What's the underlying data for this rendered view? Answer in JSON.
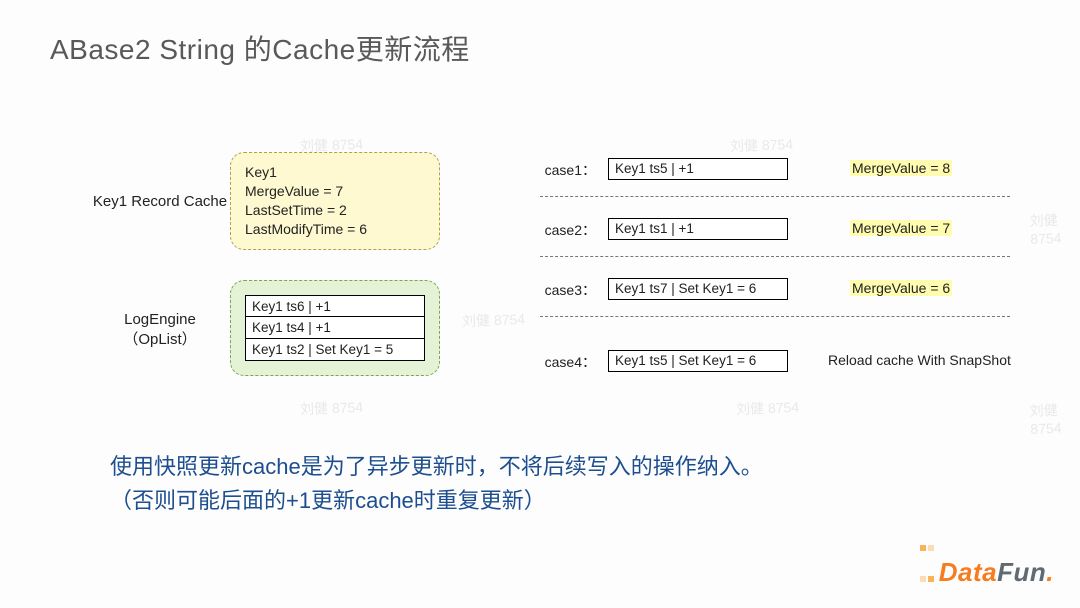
{
  "title": "ABase2 String 的Cache更新流程",
  "watermark": "刘健 8754",
  "left": {
    "record_cache_label": "Key1 Record Cache",
    "logengine_label_a": "LogEngine",
    "logengine_label_b": "（OpList）",
    "record_cache_lines": [
      "Key1",
      "MergeValue = 7",
      "LastSetTime = 2",
      "LastModifyTime = 6"
    ],
    "oplist": [
      "Key1 ts6 |  +1",
      "Key1 ts4 |  +1",
      "Key1 ts2 |  Set Key1 = 5"
    ]
  },
  "cases": [
    {
      "label": "case1：",
      "expr": "Key1 ts5 |  +1",
      "result": "MergeValue = 8",
      "hl": true
    },
    {
      "label": "case2：",
      "expr": "Key1 ts1 |  +1",
      "result": "MergeValue = 7",
      "hl": true
    },
    {
      "label": "case3：",
      "expr": "Key1 ts7 |  Set Key1 = 6",
      "result": "MergeValue = 6",
      "hl": true
    },
    {
      "label": "case4：",
      "expr": "Key1 ts5 |  Set Key1 = 6",
      "result": "Reload cache With SnapShot",
      "hl": false
    }
  ],
  "note_line1": "使用快照更新cache是为了异步更新时，不将后续写入的操作纳入。",
  "note_line2": "（否则可能后面的+1更新cache时重复更新）",
  "logo": {
    "a": "Data",
    "b": "Fun",
    "dot": "."
  }
}
